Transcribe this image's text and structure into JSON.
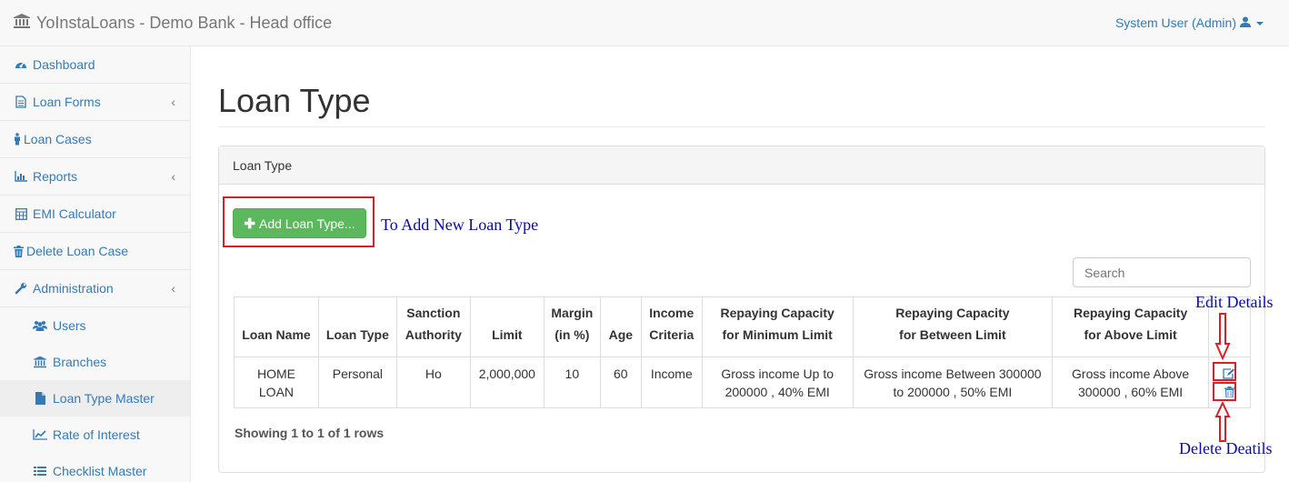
{
  "app": {
    "brand": "YoInstaLoans - Demo Bank - Head office",
    "user": "System User (Admin)"
  },
  "sidebar": {
    "items": [
      {
        "label": "Dashboard",
        "icon": "dashboard-icon"
      },
      {
        "label": "Loan Forms",
        "icon": "file-icon",
        "chevron": "‹"
      },
      {
        "label": "Loan Cases",
        "icon": "person-icon"
      },
      {
        "label": "Reports",
        "icon": "bar-chart-icon",
        "chevron": "‹"
      },
      {
        "label": "EMI Calculator",
        "icon": "calculator-icon"
      },
      {
        "label": "Delete Loan Case",
        "icon": "trash-icon"
      },
      {
        "label": "Administration",
        "icon": "wrench-icon",
        "chevron": "‹"
      }
    ],
    "subitems": [
      {
        "label": "Users",
        "icon": "users-icon"
      },
      {
        "label": "Branches",
        "icon": "bank-icon"
      },
      {
        "label": "Loan Type Master",
        "icon": "file-icon",
        "active": true
      },
      {
        "label": "Rate of Interest",
        "icon": "line-chart-icon"
      },
      {
        "label": "Checklist Master",
        "icon": "list-icon"
      }
    ]
  },
  "main": {
    "title": "Loan Type",
    "panel_heading": "Loan Type",
    "add_button": "Add Loan Type...",
    "search_placeholder": "Search",
    "showing": "Showing 1 to 1 of 1 rows"
  },
  "table": {
    "headers": [
      [
        "Loan Name"
      ],
      [
        "Loan Type"
      ],
      [
        "Sanction",
        "Authority"
      ],
      [
        "Limit"
      ],
      [
        "Margin",
        "(in %)"
      ],
      [
        "Age"
      ],
      [
        "Income",
        "Criteria"
      ],
      [
        "Repaying Capacity",
        "for Minimum Limit"
      ],
      [
        "Repaying Capacity",
        "for Between Limit"
      ],
      [
        "Repaying Capacity",
        "for Above Limit"
      ],
      [
        ""
      ]
    ],
    "rows": [
      [
        "HOME LOAN",
        "Personal",
        "Ho",
        "2,000,000",
        "10",
        "60",
        "Income",
        "Gross income Up to 200000 , 40% EMI",
        "Gross income Between 300000 to 200000 , 50% EMI",
        "Gross income Above 300000 , 60% EMI"
      ]
    ]
  },
  "annotations": {
    "add": "To Add New Loan Type",
    "edit": "Edit Details",
    "delete": "Delete Deatils"
  },
  "colors": {
    "accent": "#337ab7",
    "success": "#5cb85c",
    "highlight": "#d6202c",
    "annotation": "#0a0aa8"
  }
}
